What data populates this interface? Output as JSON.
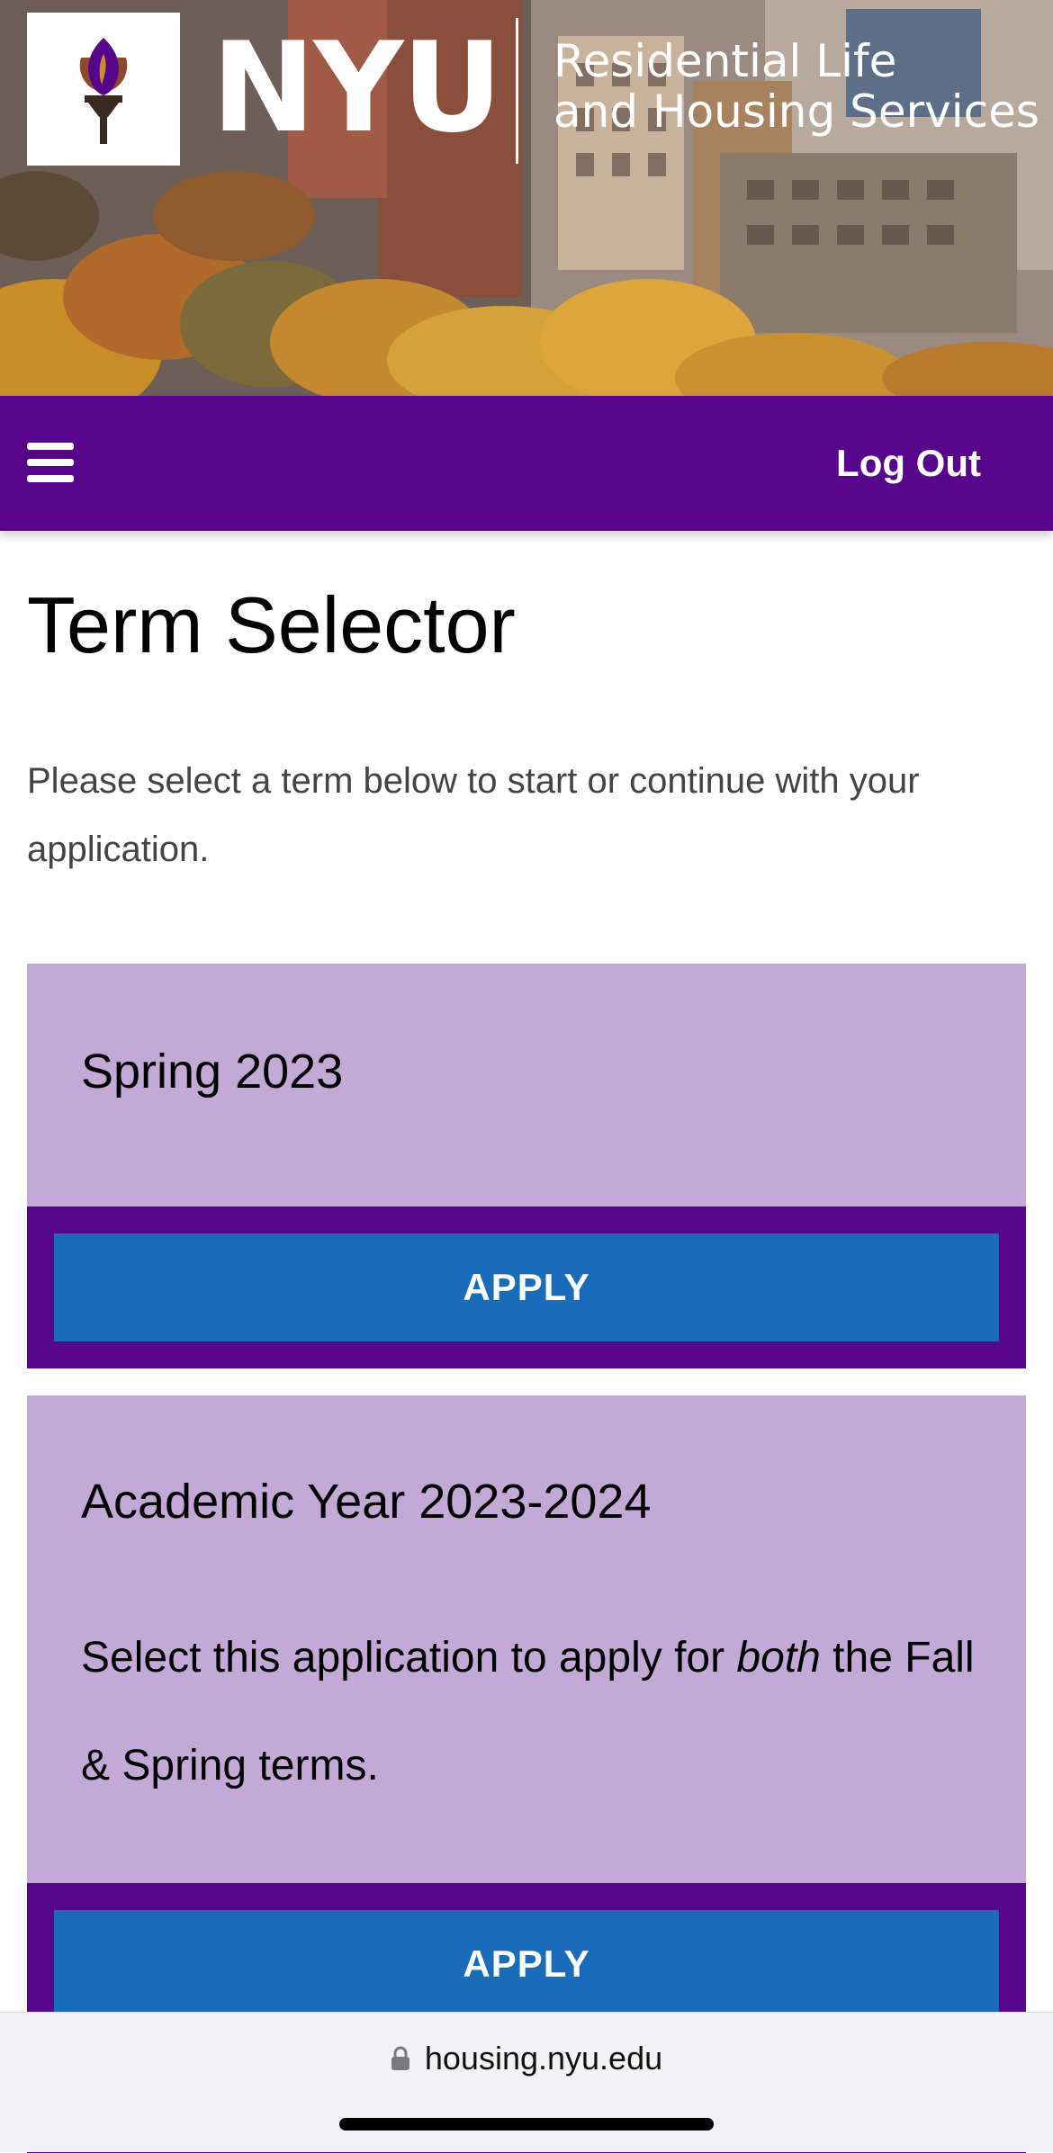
{
  "banner": {
    "brand": "NYU",
    "org_line_1": "Residential Life",
    "org_line_2": "and Housing Services"
  },
  "navbar": {
    "menu_icon": "hamburger-menu-icon",
    "logout_label": "Log Out",
    "background_color": "#57068c"
  },
  "page": {
    "title": "Term Selector",
    "intro": "Please select a term below to start or continue with your application."
  },
  "terms": [
    {
      "title": "Spring 2023",
      "apply_label": "APPLY"
    },
    {
      "title": "Academic Year 2023-2024",
      "description_before": "Select this application to apply for ",
      "description_emphasis": "both",
      "description_after": " the Fall & Spring terms.",
      "apply_label": "APPLY"
    }
  ],
  "colors": {
    "card_background": "#c3a9d6",
    "button_background": "#1a6bb8"
  },
  "browser": {
    "url": "housing.nyu.edu",
    "lock_icon": "lock-icon"
  }
}
